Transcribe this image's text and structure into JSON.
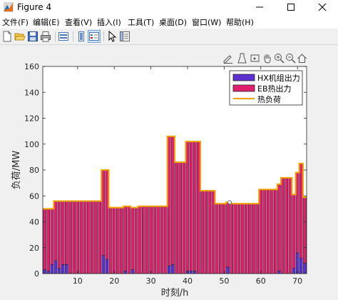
{
  "window": {
    "title": "Figure 4"
  },
  "menu": [
    "文件(F)",
    "编辑(E)",
    "查看(V)",
    "插入(I)",
    "工具(T)",
    "桌面(D)",
    "窗口(W)",
    "帮助(H)"
  ],
  "axes_toolbar_icons": [
    "edit-plot-icon",
    "data-tips-icon",
    "pan-icon",
    "zoom-in-icon",
    "zoom-out-icon",
    "home-icon"
  ],
  "chart_data": {
    "type": "bar",
    "xlabel": "时刻/h",
    "ylabel": "负荷/MW",
    "xlim": [
      0.5,
      72.5
    ],
    "ylim": [
      0,
      160
    ],
    "xticks": [
      10,
      20,
      30,
      40,
      50,
      60,
      70
    ],
    "yticks": [
      0,
      20,
      40,
      60,
      80,
      100,
      120,
      140,
      160
    ],
    "legend_position": "top-right",
    "x": [
      1,
      2,
      3,
      4,
      5,
      6,
      7,
      8,
      9,
      10,
      11,
      12,
      13,
      14,
      15,
      16,
      17,
      18,
      19,
      20,
      21,
      22,
      23,
      24,
      25,
      26,
      27,
      28,
      29,
      30,
      31,
      32,
      33,
      34,
      35,
      36,
      37,
      38,
      39,
      40,
      41,
      42,
      43,
      44,
      45,
      46,
      47,
      48,
      49,
      50,
      51,
      52,
      53,
      54,
      55,
      56,
      57,
      58,
      59,
      60,
      61,
      62,
      63,
      64,
      65,
      66,
      67,
      68,
      69,
      70,
      71,
      72
    ],
    "series": [
      {
        "name": "HX机组出力",
        "kind": "stacked-bar",
        "color": "#5b2fd0",
        "values": [
          3,
          2,
          7,
          10,
          4,
          7,
          7,
          0,
          0,
          0,
          0,
          0,
          0,
          0,
          0,
          0,
          14,
          11,
          0,
          0,
          0,
          0,
          2,
          0,
          3,
          0,
          0,
          0,
          0,
          0,
          0,
          0,
          0,
          0,
          6,
          7,
          0,
          0,
          0,
          2,
          2,
          2,
          0,
          0,
          0,
          0,
          0,
          0,
          0,
          0,
          5,
          0,
          0,
          0,
          0,
          0,
          0,
          0,
          0,
          0,
          0,
          0,
          0,
          0,
          2,
          0,
          0,
          0,
          4,
          16,
          12,
          8
        ]
      },
      {
        "name": "EB热出力",
        "kind": "stacked-bar",
        "color": "#e0206f",
        "values": [
          47,
          48,
          43,
          46,
          52,
          49,
          49,
          56,
          56,
          56,
          56,
          56,
          56,
          56,
          56,
          56,
          66,
          69,
          51,
          51,
          51,
          51,
          50,
          52,
          48,
          51,
          52,
          52,
          52,
          52,
          52,
          52,
          52,
          52,
          100,
          99,
          86,
          86,
          86,
          100,
          100,
          100,
          102,
          64,
          64,
          64,
          64,
          54,
          54,
          54,
          50,
          54,
          54,
          54,
          54,
          54,
          54,
          54,
          54,
          65,
          65,
          65,
          65,
          65,
          67,
          74,
          74,
          74,
          57,
          62,
          73,
          51
        ]
      },
      {
        "name": "热负荷",
        "kind": "step-line",
        "color": "#f0a000",
        "values": [
          50,
          50,
          50,
          56,
          56,
          56,
          56,
          56,
          56,
          56,
          56,
          56,
          56,
          56,
          56,
          56,
          80,
          80,
          51,
          51,
          51,
          51,
          52,
          52,
          51,
          51,
          52,
          52,
          52,
          52,
          52,
          52,
          52,
          52,
          106,
          106,
          86,
          86,
          86,
          102,
          102,
          102,
          102,
          64,
          64,
          64,
          64,
          54,
          54,
          54,
          55,
          54,
          54,
          54,
          54,
          54,
          54,
          54,
          54,
          65,
          65,
          65,
          65,
          65,
          69,
          74,
          74,
          74,
          61,
          78,
          85,
          59
        ]
      }
    ]
  }
}
